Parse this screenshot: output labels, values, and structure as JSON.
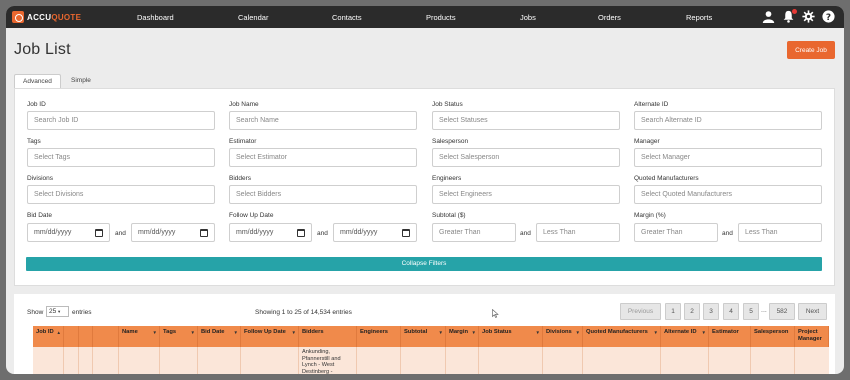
{
  "app": {
    "logo_text": "ACCU",
    "logo_accent": "QUOTE"
  },
  "nav": {
    "items": [
      "Dashboard",
      "Calendar",
      "Contacts",
      "Products",
      "Jobs",
      "Orders",
      "Reports"
    ],
    "icons": [
      "user-icon",
      "bell-icon",
      "gear-icon",
      "help-icon"
    ]
  },
  "page": {
    "title": "Job List",
    "create_label": "Create Job"
  },
  "tabs": [
    "Advanced",
    "Simple"
  ],
  "filters": {
    "job_id": {
      "label": "Job ID",
      "placeholder": "Search Job ID"
    },
    "job_name": {
      "label": "Job Name",
      "placeholder": "Search Name"
    },
    "job_status": {
      "label": "Job Status",
      "placeholder": "Select Statuses"
    },
    "alternate_id": {
      "label": "Alternate ID",
      "placeholder": "Search Alternate ID"
    },
    "tags": {
      "label": "Tags",
      "placeholder": "Select Tags"
    },
    "estimator": {
      "label": "Estimator",
      "placeholder": "Select Estimator"
    },
    "salesperson": {
      "label": "Salesperson",
      "placeholder": "Select Salesperson"
    },
    "manager": {
      "label": "Manager",
      "placeholder": "Select Manager"
    },
    "divisions": {
      "label": "Divisions",
      "placeholder": "Select Divisions"
    },
    "bidders": {
      "label": "Bidders",
      "placeholder": "Select Bidders"
    },
    "engineers": {
      "label": "Engineers",
      "placeholder": "Select Engineers"
    },
    "quoted_manufacturers": {
      "label": "Quoted Manufacturers",
      "placeholder": "Select Quoted Manufacturers"
    },
    "bid_date": {
      "label": "Bid Date",
      "from": "mm/dd/yyyy",
      "to": "mm/dd/yyyy"
    },
    "follow_up_date": {
      "label": "Follow Up Date",
      "from": "mm/dd/yyyy",
      "to": "mm/dd/yyyy"
    },
    "subtotal": {
      "label": "Subtotal ($)",
      "min": "Greater Than",
      "max": "Less Than"
    },
    "margin": {
      "label": "Margin (%)",
      "min": "Greater Than",
      "max": "Less Than"
    },
    "and_label": "and",
    "collapse_label": "Collapse Filters"
  },
  "results": {
    "show_label": "Show",
    "page_size": "25",
    "entries_label": "entries",
    "summary": "Showing 1 to 25 of 14,534 entries",
    "pagination": {
      "previous": "Previous",
      "pages": [
        "1",
        "2",
        "3",
        "4",
        "5"
      ],
      "ellipsis": "...",
      "last": "582",
      "next": "Next"
    }
  },
  "table": {
    "columns": [
      "Job ID",
      "",
      "",
      "",
      "Name",
      "Tags",
      "Bid Date",
      "Follow Up Date",
      "Bidders",
      "Engineers",
      "Subtotal",
      "Margin",
      "Job Status",
      "Divisions",
      "Quoted Manufacturers",
      "Alternate ID",
      "Estimator",
      "Salesperson",
      "Project Manager"
    ],
    "rows": [
      {
        "bidders": "Ankunding, Pfannerstill and Lynch - West Destinberg - Vincenzo Rohan"
      }
    ]
  }
}
